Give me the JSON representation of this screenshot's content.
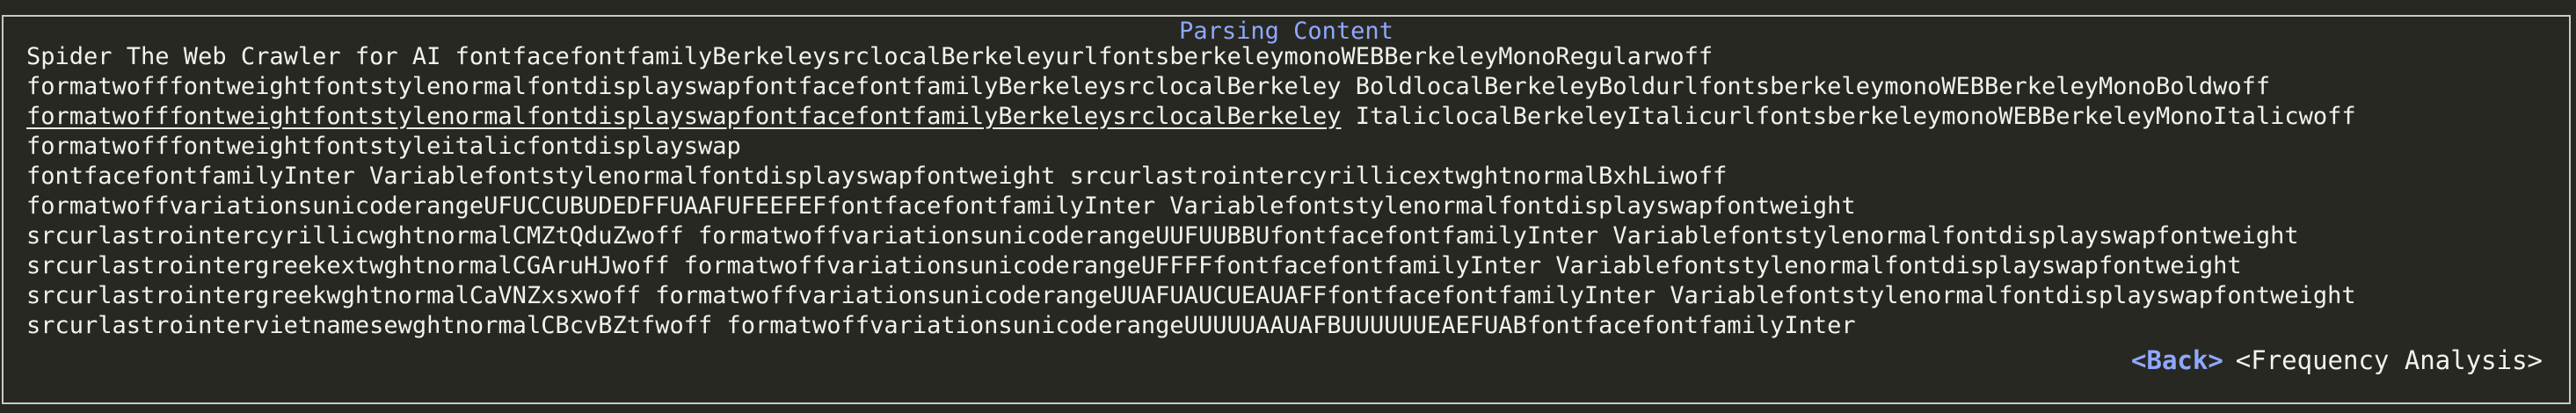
{
  "panel": {
    "title": "Parsing Content"
  },
  "content": {
    "lines": [
      {
        "pre": "Spider The Web Crawler for AI fontfacefontfamilyBerkeleysrclocalBerkeleyurlfontsberkeleymonoWEBBerkeleyMonoRegularwoff",
        "underlined": "",
        "post": ""
      },
      {
        "pre": "formatwofffontweightfontstylenormalfontdisplayswapfontfacefontfamilyBerkeleysrclocalBerkeley BoldlocalBerkeleyBoldurlfontsberkeleymonoWEBBerkeleyMonoBoldwoff",
        "underlined": "",
        "post": ""
      },
      {
        "pre": "",
        "underlined": "formatwofffontweightfontstylenormalfontdisplayswapfontfacefontfamilyBerkeleysrclocalBerkeley",
        "post": " ItaliclocalBerkeleyItalicurlfontsberkeleymonoWEBBerkeleyMonoItalicwoff"
      },
      {
        "pre": "formatwofffontweightfontstyleitalicfontdisplayswap",
        "underlined": "",
        "post": ""
      },
      {
        "pre": "fontfacefontfamilyInter Variablefontstylenormalfontdisplayswapfontweight srcurlastrointercyrillicextwghtnormalBxhLiwoff",
        "underlined": "",
        "post": ""
      },
      {
        "pre": "formatwoffvariationsunicoderangeUFUCCUBUDEDFFUAAFUFEEFEFfontfacefontfamilyInter Variablefontstylenormalfontdisplayswapfontweight",
        "underlined": "",
        "post": ""
      },
      {
        "pre": "srcurlastrointercyrillicwghtnormalCMZtQduZwoff formatwoffvariationsunicoderangeUUFUUBBUfontfacefontfamilyInter Variablefontstylenormalfontdisplayswapfontweight",
        "underlined": "",
        "post": ""
      },
      {
        "pre": "srcurlastrointergreekextwghtnormalCGAruHJwoff formatwoffvariationsunicoderangeUFFFFfontfacefontfamilyInter Variablefontstylenormalfontdisplayswapfontweight",
        "underlined": "",
        "post": ""
      },
      {
        "pre": "srcurlastrointergreekwghtnormalCaVNZxsxwoff formatwoffvariationsunicoderangeUUAFUAUCUEAUAFFfontfacefontfamilyInter Variablefontstylenormalfontdisplayswapfontweight",
        "underlined": "",
        "post": ""
      },
      {
        "pre": "srcurlastrointervietnamesewghtnormalCBcvBZtfwoff formatwoffvariationsunicoderangeUUUUUAAUAFBUUUUUUEAEFUABfontfacefontfamilyInter",
        "underlined": "",
        "post": ""
      }
    ]
  },
  "footer": {
    "back_label": "<Back>",
    "frequency_label": "<Frequency Analysis>"
  },
  "colors": {
    "background": "#272822",
    "text": "#f2f2ee",
    "accent": "#8fa8ff",
    "border": "#c9c9c4"
  }
}
